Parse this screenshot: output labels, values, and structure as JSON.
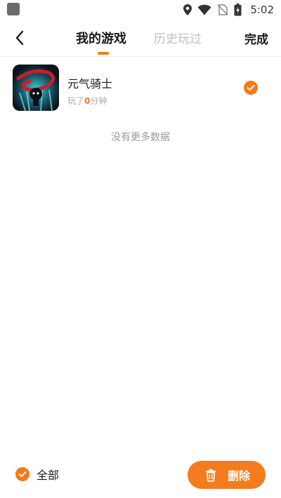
{
  "status_bar": {
    "time": "5:02",
    "icons": [
      "location-icon",
      "wifi-icon",
      "no-sim-icon",
      "battery-charging-icon"
    ]
  },
  "nav": {
    "tabs": [
      {
        "label": "我的游戏",
        "active": true
      },
      {
        "label": "历史玩过",
        "active": false
      }
    ],
    "done_label": "完成",
    "back_icon": "back-arrow-icon"
  },
  "games": [
    {
      "title": "元气骑士",
      "played_prefix": "玩了",
      "played_minutes": "0",
      "played_suffix": "分钟",
      "selected": true
    }
  ],
  "list_footer": "没有更多数据",
  "bottom_bar": {
    "select_all_label": "全部",
    "select_all_checked": true,
    "delete_label": "删除",
    "delete_icon": "trash-icon"
  },
  "colors": {
    "accent": "#f27a1a",
    "tab_inactive": "#c0c0c0",
    "muted_text": "#9a9a9a"
  }
}
